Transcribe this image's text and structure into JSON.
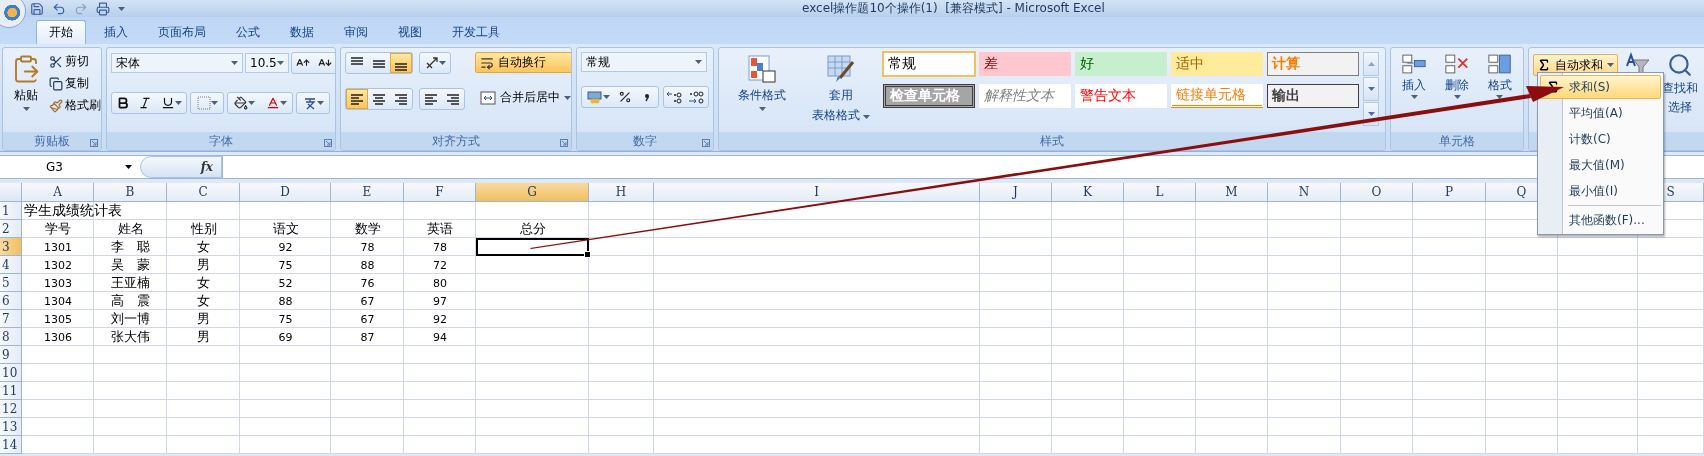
{
  "window": {
    "title": "excel操作题10个操作(1)  [兼容模式] - Microsoft Excel"
  },
  "tabs": [
    {
      "label": "开始",
      "selected": true
    },
    {
      "label": "插入",
      "selected": false
    },
    {
      "label": "页面布局",
      "selected": false
    },
    {
      "label": "公式",
      "selected": false
    },
    {
      "label": "数据",
      "selected": false
    },
    {
      "label": "审阅",
      "selected": false
    },
    {
      "label": "视图",
      "selected": false
    },
    {
      "label": "开发工具",
      "selected": false
    }
  ],
  "ribbon": {
    "clipboard": {
      "label": "剪贴板",
      "paste": "粘贴",
      "actions": [
        "剪切",
        "复制",
        "格式刷"
      ]
    },
    "font": {
      "label": "字体",
      "font_name": "宋体",
      "font_size": "10.5"
    },
    "alignment": {
      "label": "对齐方式",
      "vertical": [
        {
          "kind": "top",
          "selected": false
        },
        {
          "kind": "middle",
          "selected": false
        },
        {
          "kind": "bottom",
          "selected": true
        }
      ],
      "horizontal": [
        {
          "kind": "left",
          "selected": true
        },
        {
          "kind": "center",
          "selected": false
        },
        {
          "kind": "right",
          "selected": false
        }
      ],
      "wrap_text": {
        "label": "自动换行",
        "on": true
      },
      "merge": "合并后居中"
    },
    "number": {
      "label": "数字",
      "format": "常规"
    },
    "styles": {
      "label": "样式",
      "conditional_format": "条件格式",
      "table_format": [
        "套用",
        "表格格式"
      ],
      "cell_styles": [
        {
          "label": "常规",
          "kind": "normal",
          "selected": true
        },
        {
          "label": "差",
          "kind": "bad",
          "selected": false
        },
        {
          "label": "好",
          "kind": "good",
          "selected": false
        },
        {
          "label": "适中",
          "kind": "neutral",
          "selected": false
        },
        {
          "label": "计算",
          "kind": "calc",
          "selected": false
        },
        {
          "label": "检查单元格",
          "kind": "check",
          "selected": false
        },
        {
          "label": "解释性文本",
          "kind": "explanatory",
          "selected": false
        },
        {
          "label": "警告文本",
          "kind": "warning",
          "selected": false
        },
        {
          "label": "链接单元格",
          "kind": "linked",
          "selected": false
        },
        {
          "label": "输出",
          "kind": "output",
          "selected": false
        }
      ]
    },
    "cells": {
      "label": "单元格",
      "actions": [
        "插入",
        "删除",
        "格式"
      ]
    },
    "editing": {
      "autosum": "自动求和",
      "find_select": [
        "查找和",
        "选择"
      ]
    }
  },
  "formula_bar": {
    "name_box": "G3",
    "fx": "fx"
  },
  "sheet": {
    "columns": [
      {
        "label": "A",
        "selected": false
      },
      {
        "label": "B",
        "selected": false
      },
      {
        "label": "C",
        "selected": false
      },
      {
        "label": "D",
        "selected": false
      },
      {
        "label": "E",
        "selected": false
      },
      {
        "label": "F",
        "selected": false
      },
      {
        "label": "G",
        "selected": true
      },
      {
        "label": "H",
        "selected": false
      },
      {
        "label": "I",
        "selected": false
      },
      {
        "label": "J",
        "selected": false
      },
      {
        "label": "K",
        "selected": false
      },
      {
        "label": "L",
        "selected": false
      },
      {
        "label": "M",
        "selected": false
      },
      {
        "label": "N",
        "selected": false
      },
      {
        "label": "O",
        "selected": false
      },
      {
        "label": "P",
        "selected": false
      },
      {
        "label": "Q",
        "selected": false
      },
      {
        "label": "S",
        "selected": false
      }
    ],
    "rows": [
      {
        "number": "1",
        "selected": false,
        "title": "学生成绩统计表",
        "cells": []
      },
      {
        "number": "2",
        "selected": false,
        "cells": [
          "学号",
          "姓名",
          "性别",
          "语文",
          "数学",
          "英语",
          "总分"
        ]
      },
      {
        "number": "3",
        "selected": true,
        "cells": [
          "1301",
          "李　聪",
          "女",
          "92",
          "78",
          "78"
        ]
      },
      {
        "number": "4",
        "selected": false,
        "cells": [
          "1302",
          "吴　蒙",
          "男",
          "75",
          "88",
          "72"
        ]
      },
      {
        "number": "5",
        "selected": false,
        "cells": [
          "1303",
          "王亚楠",
          "女",
          "52",
          "76",
          "80"
        ]
      },
      {
        "number": "6",
        "selected": false,
        "cells": [
          "1304",
          "高　震",
          "女",
          "88",
          "67",
          "97"
        ]
      },
      {
        "number": "7",
        "selected": false,
        "cells": [
          "1305",
          "刘一博",
          "男",
          "75",
          "67",
          "92"
        ]
      },
      {
        "number": "8",
        "selected": false,
        "cells": [
          "1306",
          "张大伟",
          "男",
          "69",
          "87",
          "94"
        ]
      },
      {
        "number": "9",
        "selected": false,
        "cells": []
      },
      {
        "number": "10",
        "selected": false,
        "cells": []
      },
      {
        "number": "11",
        "selected": false,
        "cells": []
      },
      {
        "number": "12",
        "selected": false,
        "cells": []
      },
      {
        "number": "13",
        "selected": false,
        "cells": []
      },
      {
        "number": "14",
        "selected": false,
        "cells": []
      }
    ]
  },
  "autosum_menu": {
    "items": [
      {
        "label": "求和(S)",
        "selected": true
      },
      {
        "label": "平均值(A)",
        "selected": false
      },
      {
        "label": "计数(C)",
        "selected": false
      },
      {
        "label": "最大值(M)",
        "selected": false
      },
      {
        "label": "最小值(I)",
        "selected": false
      },
      {
        "label": "其他函数(F)...",
        "selected": false
      }
    ]
  }
}
